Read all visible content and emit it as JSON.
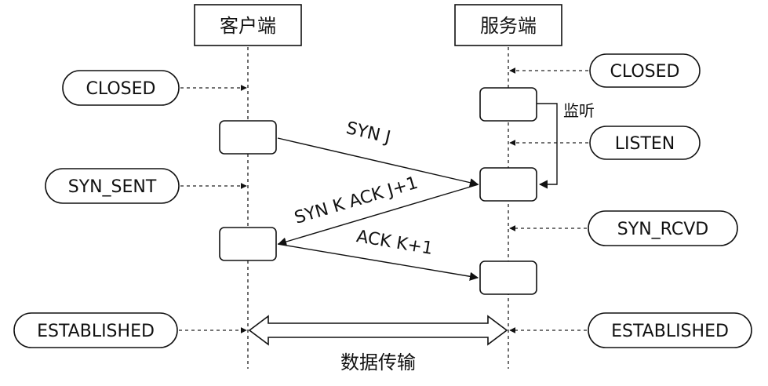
{
  "lanes": {
    "client": "客户端",
    "server": "服务端"
  },
  "client_states": {
    "closed": "CLOSED",
    "syn_sent": "SYN_SENT",
    "established": "ESTABLISHED"
  },
  "server_states": {
    "closed": "CLOSED",
    "listen": "LISTEN",
    "syn_rcvd": "SYN_RCVD",
    "established": "ESTABLISHED"
  },
  "messages": {
    "syn": "SYN J",
    "syn_ack": "SYN K ACK J+1",
    "ack": "ACK K+1"
  },
  "annotations": {
    "listen_label": "监听",
    "data_transfer": "数据传输"
  }
}
